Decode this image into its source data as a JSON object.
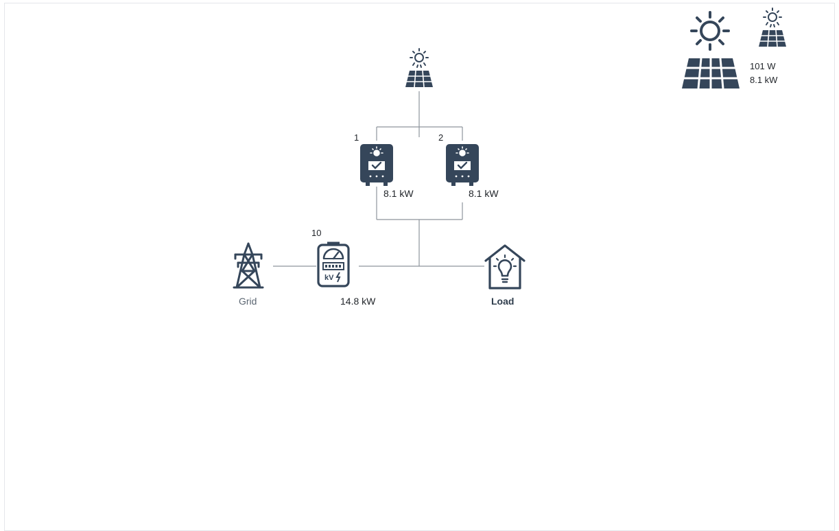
{
  "summary": {
    "power": "101 W",
    "capacity": "8.1 kW"
  },
  "inverters": [
    {
      "number": "1",
      "power": "8.1 kW"
    },
    {
      "number": "2",
      "power": "8.1 kW"
    }
  ],
  "meter": {
    "number": "10",
    "power": "14.8 kW"
  },
  "grid": {
    "label": "Grid"
  },
  "load": {
    "label": "Load"
  },
  "colors": {
    "icon": "#35465a",
    "wire": "#8d949c",
    "background": "#ffffff"
  },
  "icons": [
    "sun-large-icon",
    "solar-panel-icon",
    "inverter-icon",
    "electric-meter-icon",
    "transmission-tower-icon",
    "house-lightbulb-icon"
  ]
}
